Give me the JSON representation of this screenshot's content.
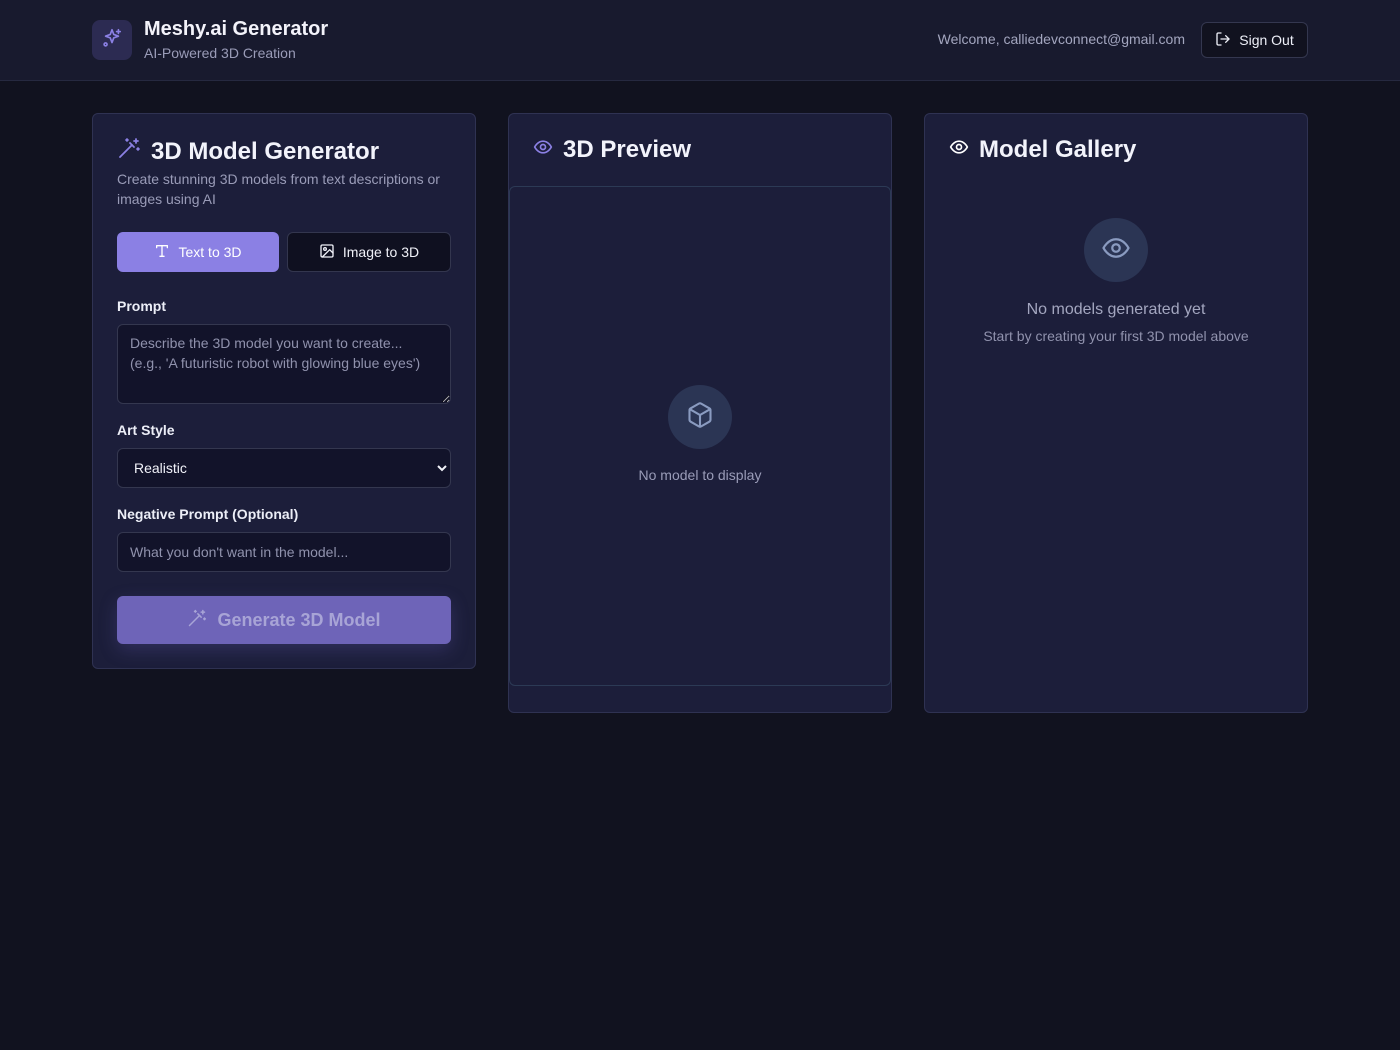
{
  "header": {
    "title": "Meshy.ai Generator",
    "subtitle": "AI-Powered 3D Creation",
    "welcome": "Welcome, calliedevconnect@gmail.com",
    "sign_out": "Sign Out"
  },
  "generator": {
    "title": "3D Model Generator",
    "description": "Create stunning 3D models from text descriptions or images using AI",
    "tabs": {
      "text": "Text to 3D",
      "image": "Image to 3D",
      "active": "text"
    },
    "prompt_label": "Prompt",
    "prompt_placeholder": "Describe the 3D model you want to create... (e.g., 'A futuristic robot with glowing blue eyes')",
    "art_style_label": "Art Style",
    "art_style_value": "Realistic",
    "negative_label": "Negative Prompt (Optional)",
    "negative_placeholder": "What you don't want in the model...",
    "generate_button": "Generate 3D Model"
  },
  "preview": {
    "title": "3D Preview",
    "empty_text": "No model to display"
  },
  "gallery": {
    "title": "Model Gallery",
    "empty_title": "No models generated yet",
    "empty_subtitle": "Start by creating your first 3D model above"
  },
  "icons": {
    "logo": "sparkles-icon",
    "sign_out": "log-out-icon",
    "generator": "wand-sparkles-icon",
    "text_tab": "type-icon",
    "image_tab": "image-icon",
    "preview": "eye-icon",
    "gallery": "eye-icon",
    "preview_empty": "box-icon",
    "gallery_empty": "eye-icon"
  },
  "colors": {
    "accent": "#8b80e4",
    "background": "#11121f",
    "card": "#1c1e3a"
  }
}
